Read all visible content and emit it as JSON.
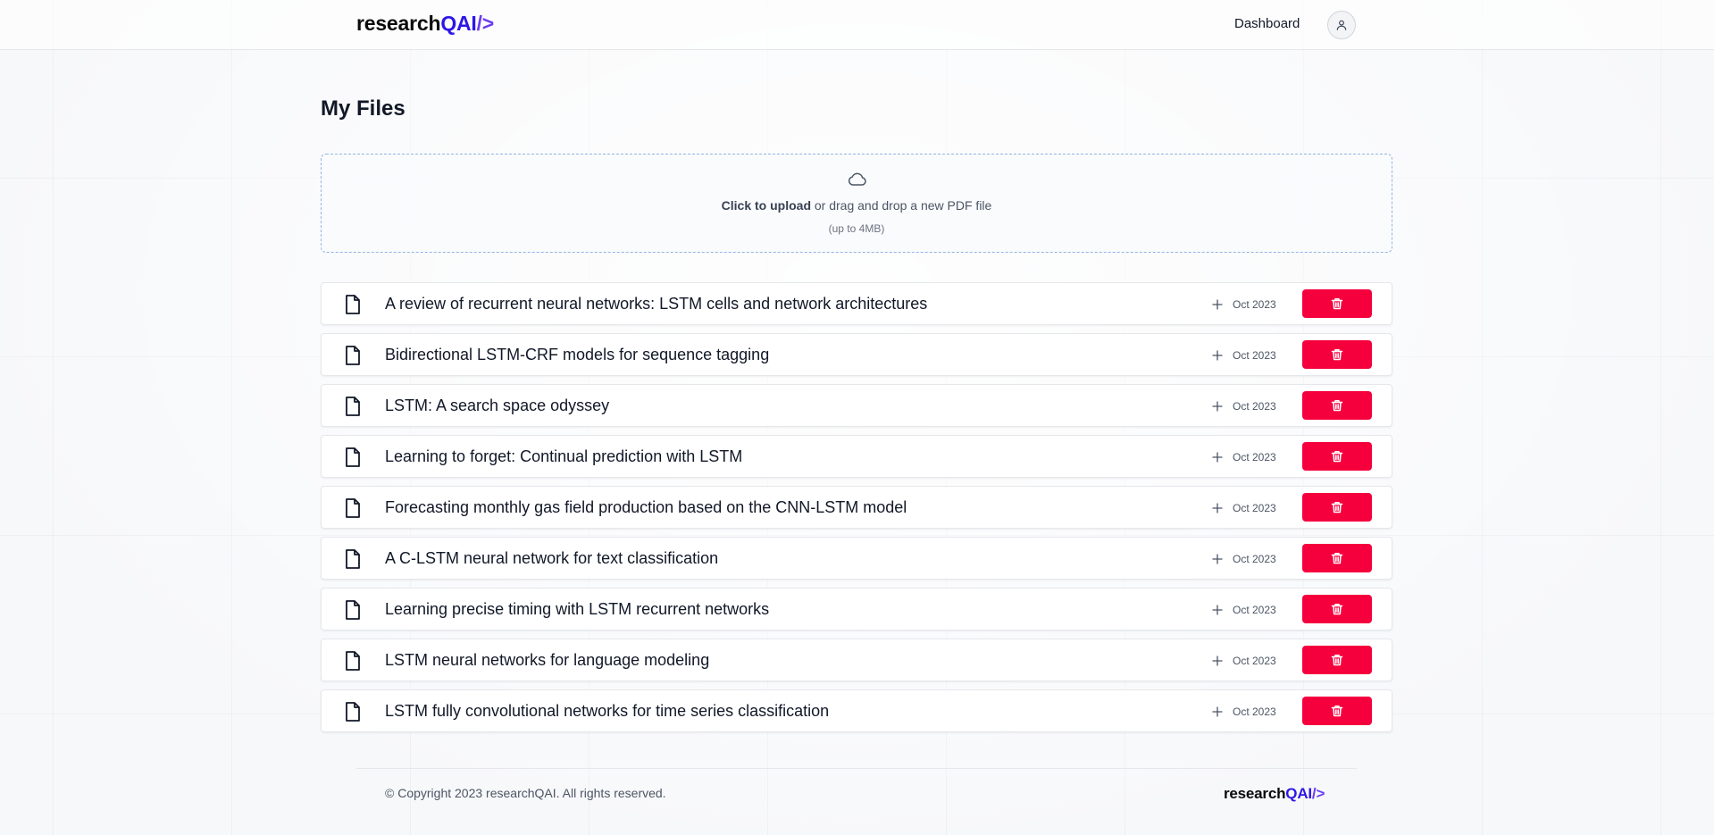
{
  "header": {
    "logo": {
      "part1": "research",
      "part2": "QAI",
      "part3": "/>"
    },
    "nav_dashboard": "Dashboard",
    "avatar_icon": "user-icon"
  },
  "main": {
    "title": "My Files",
    "upload": {
      "icon": "cloud-icon",
      "click_text": "Click to upload",
      "rest_text": " or drag and drop a new PDF file",
      "limit": "(up to 4MB)"
    },
    "files": [
      {
        "title": "A review of recurrent neural networks: LSTM cells and network architectures",
        "date": "Oct 2023"
      },
      {
        "title": "Bidirectional LSTM-CRF models for sequence tagging",
        "date": "Oct 2023"
      },
      {
        "title": "LSTM: A search space odyssey",
        "date": "Oct 2023"
      },
      {
        "title": "Learning to forget: Continual prediction with LSTM",
        "date": "Oct 2023"
      },
      {
        "title": "Forecasting monthly gas field production based on the CNN-LSTM model",
        "date": "Oct 2023"
      },
      {
        "title": "A C-LSTM neural network for text classification",
        "date": "Oct 2023"
      },
      {
        "title": "Learning precise timing with LSTM recurrent networks",
        "date": "Oct 2023"
      },
      {
        "title": "LSTM neural networks for language modeling",
        "date": "Oct 2023"
      },
      {
        "title": "LSTM fully convolutional networks for time series classification",
        "date": "Oct 2023"
      }
    ]
  },
  "footer": {
    "copyright": "© Copyright 2023 researchQAI. All rights reserved.",
    "logo": {
      "part1": "research",
      "part2": "QAI",
      "part3": "/>"
    }
  },
  "colors": {
    "brand_blue": "#2d16e8",
    "brand_purple": "#6b3df2",
    "delete_red": "#f5003d"
  }
}
